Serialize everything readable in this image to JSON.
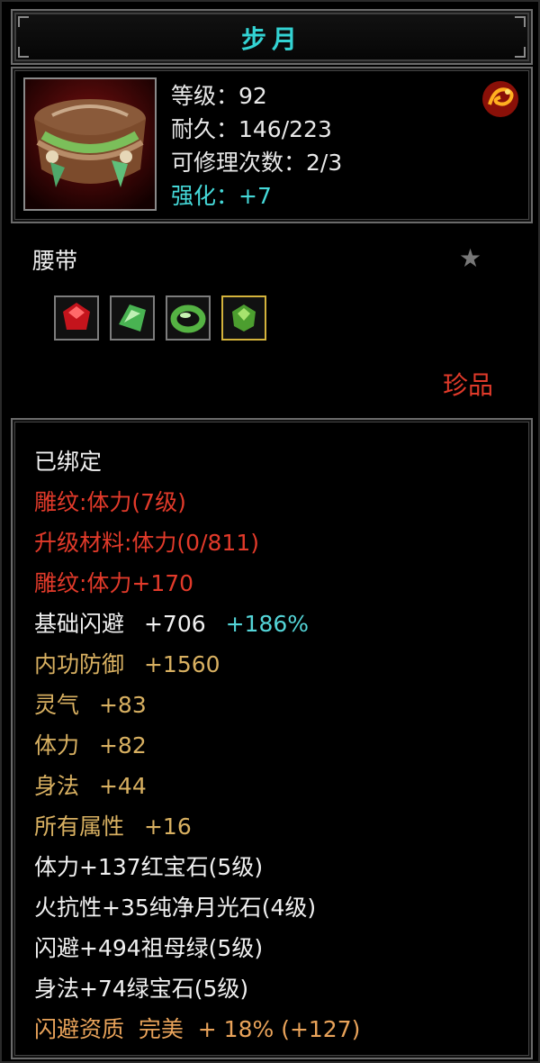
{
  "title": "步月",
  "stats": {
    "level": "等级：92",
    "durability": "耐久：146/223",
    "repair": "可修理次数：2/3",
    "enhance": "强化：+7"
  },
  "item_type": "腰带",
  "star_icon": "star-icon",
  "gems": [
    "ruby-gem-icon",
    "emerald-shard-icon",
    "jade-ring-icon",
    "green-gem-icon"
  ],
  "rarity": "珍品",
  "attributes": [
    {
      "text": "已绑定",
      "color": "white"
    },
    {
      "text": "雕纹:体力(7级)",
      "color": "red"
    },
    {
      "text": "升级材料:体力(0/811)",
      "color": "red"
    },
    {
      "text": "雕纹:体力+170",
      "color": "red"
    },
    {
      "text": "基础闪避",
      "value": "+706",
      "extra": "+186%",
      "color": "white"
    },
    {
      "text": "内功防御",
      "value": "+1560",
      "color": "gold"
    },
    {
      "text": "灵气",
      "value": "+83",
      "color": "gold"
    },
    {
      "text": "体力",
      "value": "+82",
      "color": "gold"
    },
    {
      "text": "身法",
      "value": "+44",
      "color": "gold"
    },
    {
      "text": "所有属性",
      "value": "+16",
      "color": "gold"
    },
    {
      "text": "体力+137红宝石(5级)",
      "color": "white"
    },
    {
      "text": "火抗性+35纯净月光石(4级)",
      "color": "white"
    },
    {
      "text": "闪避+494祖母绿(5级)",
      "color": "white"
    },
    {
      "text": "身法+74绿宝石(5级)",
      "color": "white"
    },
    {
      "text": "闪避资质  完美  + 18% (+127)",
      "color": "orange"
    }
  ]
}
